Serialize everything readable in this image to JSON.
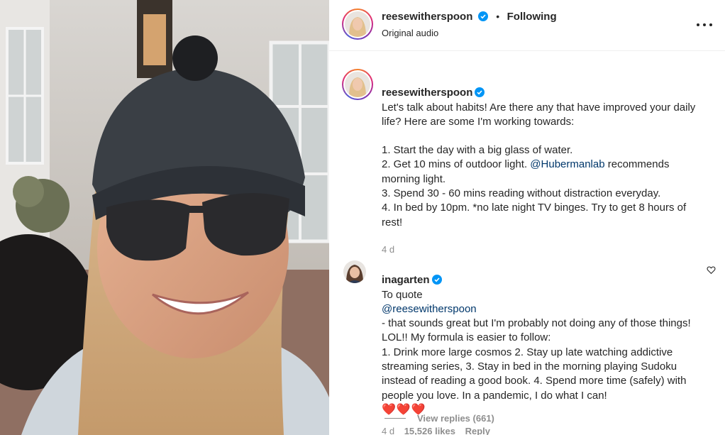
{
  "header": {
    "username": "reesewitherspoon",
    "separator": "•",
    "follow_state": "Following",
    "audio": "Original audio",
    "more_icon": "more-horizontal-icon"
  },
  "caption": {
    "username": "reesewitherspoon",
    "line1": "Let's talk about habits! Are there any that have improved your daily life? Here are some I'm working towards:",
    "item1": "1. Start the day with a big glass of water.",
    "item2_prefix": "2. Get 10 mins of outdoor light.",
    "item2_mention": "@Hubermanlab",
    "item2_suffix": "recommends morning light.",
    "item3": "3. Spend 30 - 60 mins reading without distraction everyday.",
    "item4": "4. In bed by 10pm. *no late night TV binges. Try to get  8 hours of rest!",
    "time": "4 d"
  },
  "comment": {
    "username": "inagarten",
    "prefix": "To quote",
    "mention": "@reesewitherspoon",
    "body": "- that sounds great but I'm probably not doing any of those things! LOL!! My formula is easier to follow:\n1. Drink more large cosmos 2. Stay up late watching addictive streaming series, 3. Stay in bed in the morning playing Sudoku instead of reading a good book. 4. Spend more time (safely) with people you love. In a pandemic, I do what I can!",
    "hearts": "❤️❤️❤️",
    "time": "4 d",
    "likes": "15,526 likes",
    "reply": "Reply",
    "like_icon": "heart-outline-icon"
  },
  "replies": {
    "label": "View replies (661)"
  },
  "colors": {
    "verified": "#0095f6",
    "mention": "#00376b",
    "secondary_text": "#8e8e8e"
  }
}
